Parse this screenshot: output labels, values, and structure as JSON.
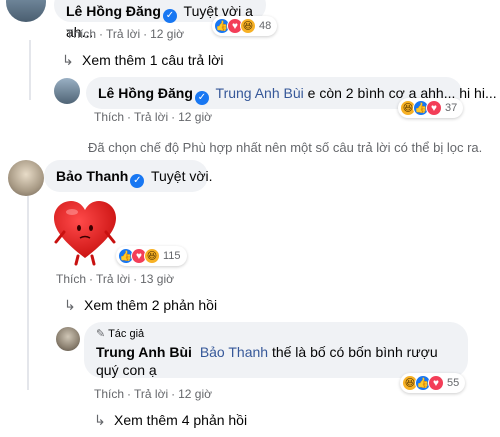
{
  "comment1": {
    "author": "Lê Hồng Đăng",
    "text": "Tuyệt vời a ah...",
    "reaction_count": "48",
    "like_label": "Thích",
    "reply_label": "Trả lời",
    "time": "12 giờ",
    "more_replies": "Xem thêm 1 câu trả lời"
  },
  "reply1": {
    "author": "Lê Hồng Đăng",
    "mention": "Trung Anh Bùi",
    "text": "e còn 2 bình cơ a ahh... hi hi...",
    "reaction_count": "37",
    "like_label": "Thích",
    "reply_label": "Trả lời",
    "time": "12 giờ"
  },
  "filter_notice": "Đã chọn chế độ Phù hợp nhất nên một số câu trả lời có thể bị lọc ra.",
  "comment2": {
    "author": "Bảo Thanh",
    "text": "Tuyệt vời.",
    "reaction_count": "115",
    "like_label": "Thích",
    "reply_label": "Trả lời",
    "time": "13 giờ",
    "more_replies": "Xem thêm 2 phản hồi"
  },
  "reply2": {
    "badge": "Tác giả",
    "author": "Trung Anh Bùi",
    "mention": "Bảo Thanh",
    "text": "thế là bố có bốn bình rượu quý con ạ",
    "reaction_count": "55",
    "like_label": "Thích",
    "reply_label": "Trả lời",
    "time": "12 giờ",
    "more_replies": "Xem thêm 4 phản hồi"
  },
  "colors": {
    "bubble": "#f0f2f5",
    "like": "#1877f2",
    "love": "#f33e58",
    "haha": "#f7b125",
    "mention": "#365899",
    "meta": "#65676b"
  },
  "icons": [
    "verified-badge-icon",
    "like-reaction-icon",
    "love-reaction-icon",
    "haha-reaction-icon",
    "reply-arrow-icon",
    "heart-sticker",
    "pencil-icon"
  ]
}
